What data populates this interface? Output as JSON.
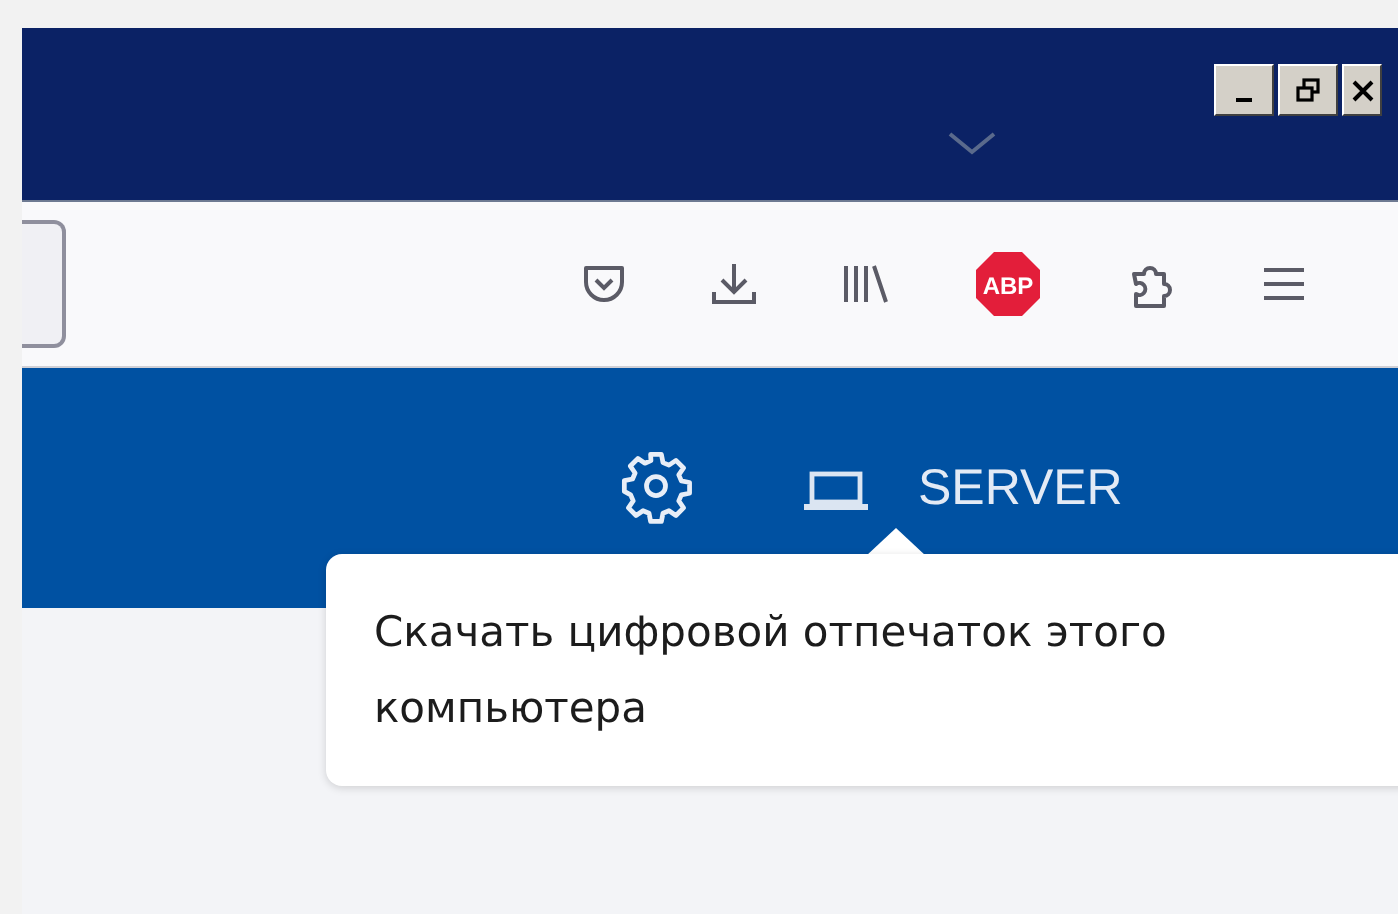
{
  "header": {
    "server_label": "SERVER"
  },
  "toolbar": {
    "adblock_label": "ABP"
  },
  "tooltip": {
    "text": "Скачать цифровой отпечаток этого компьютера"
  }
}
